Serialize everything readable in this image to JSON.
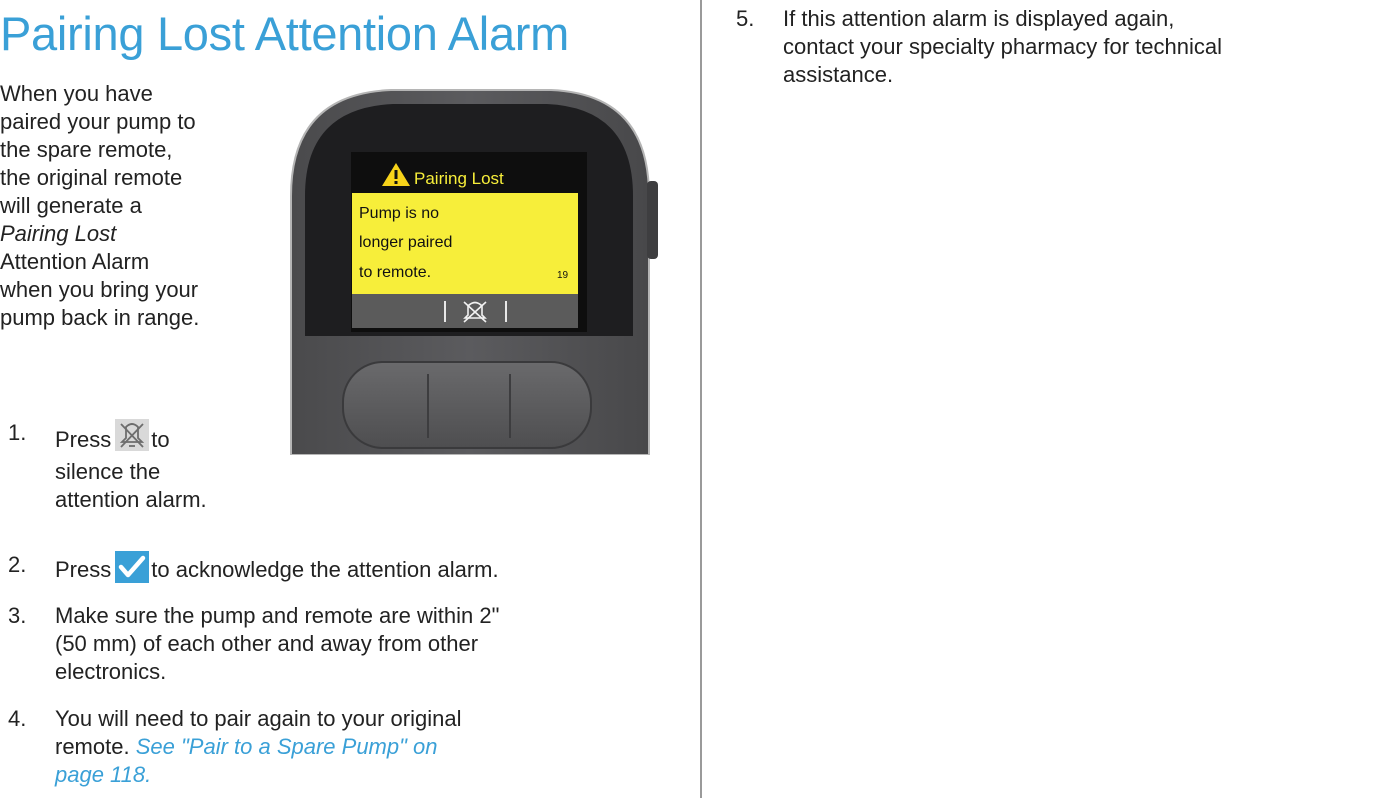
{
  "title": "Pairing Lost Attention Alarm",
  "intro": {
    "line1": "When you have",
    "line2": "paired your pump to",
    "line3": "the spare remote,",
    "line4": "the original remote",
    "line5": "will generate a",
    "italic": "Pairing Lost",
    "line7": "Attention Alarm",
    "line8": "when you bring your",
    "line9": "pump back in range."
  },
  "steps": {
    "s1": {
      "num": "1.",
      "press": "Press",
      "l1_rest": "to",
      "l2": "silence the",
      "l3": "attention alarm."
    },
    "s2": {
      "num": "2.",
      "press": "Press",
      "rest": "to acknowledge the attention alarm."
    },
    "s3": {
      "num": "3.",
      "l1": "Make sure the pump and remote are within 2\"",
      "l2": "(50 mm) of each other and away from other",
      "l3": "electronics."
    },
    "s4": {
      "num": "4.",
      "l1": "You will need to pair again to your original",
      "l2_text": "remote.",
      "l2_link": "See \"Pair to a Spare Pump\" on",
      "l3_link": "page 118."
    },
    "s5": {
      "num": "5.",
      "l1": "If this attention alarm is displayed again,",
      "l2": "contact your specialty pharmacy for technical",
      "l3": "assistance."
    }
  },
  "device": {
    "header": "Pairing Lost",
    "msg1": "Pump is no",
    "msg2": "longer paired",
    "msg3": "to remote.",
    "code": "19"
  },
  "icons": {
    "silence": "bell-silence-icon",
    "check": "checkmark-icon",
    "warning": "warning-triangle-icon"
  },
  "colors": {
    "title": "#3aa0d7",
    "link": "#3aa0d7",
    "screen_yellow": "#f7ee3a",
    "check_bg": "#3aa0d7"
  }
}
